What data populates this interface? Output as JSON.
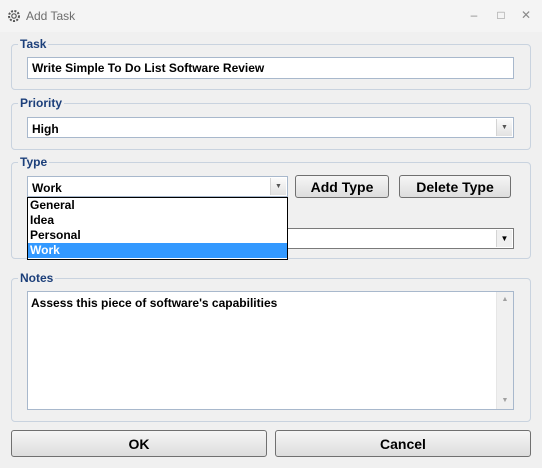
{
  "window": {
    "title": "Add Task",
    "minimize_glyph": "–",
    "maximize_glyph": "□",
    "close_glyph": "✕"
  },
  "task": {
    "legend": "Task",
    "value": "Write Simple To Do List Software Review"
  },
  "priority": {
    "legend": "Priority",
    "selected": "High"
  },
  "type": {
    "legend": "Type",
    "selected": "Work",
    "add_label": "Add Type",
    "delete_label": "Delete Type",
    "options": [
      "General",
      "Idea",
      "Personal",
      "Work"
    ],
    "highlighted_index": 3
  },
  "notes": {
    "legend": "Notes",
    "value": "Assess this piece of software's capabilities"
  },
  "buttons": {
    "ok": "OK",
    "cancel": "Cancel"
  },
  "colors": {
    "accent": "#3399ff",
    "legend": "#1c3f7a"
  }
}
